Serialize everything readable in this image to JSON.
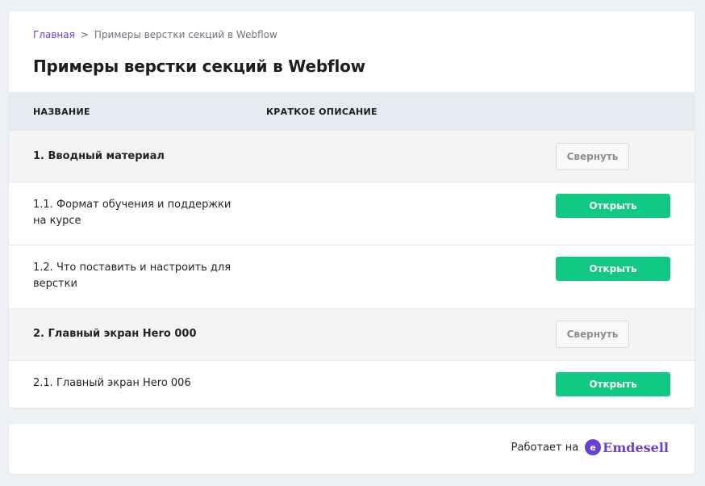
{
  "breadcrumb": {
    "home": "Главная",
    "separator": ">",
    "current": "Примеры верстки секций в Webflow"
  },
  "page_title": "Примеры верстки секций в Webflow",
  "table": {
    "columns": [
      "НАЗВАНИЕ",
      "КРАТКОЕ ОПИСАНИЕ"
    ],
    "rows": [
      {
        "type": "section",
        "title": "1. Вводный материал",
        "button": "Свернуть"
      },
      {
        "type": "lesson",
        "title": "1.1. Формат обучения и поддержки на курсе",
        "button": "Открыть"
      },
      {
        "type": "lesson",
        "title": "1.2. Что поставить и настроить для верстки",
        "button": "Открыть"
      },
      {
        "type": "section",
        "title": "2. Главный экран Hero 000",
        "button": "Свернуть"
      },
      {
        "type": "lesson",
        "title": "2.1. Главный экран Hero 006",
        "button": "Открыть"
      }
    ]
  },
  "footer": {
    "powered_by": "Работает на",
    "brand_logo_letter": "e",
    "brand_name": "Emdesell"
  },
  "colors": {
    "accent_purple": "#6a3fd1",
    "button_green": "#10c982",
    "table_header_bg": "#e6eaf1",
    "section_row_bg": "#f4f4f4"
  }
}
